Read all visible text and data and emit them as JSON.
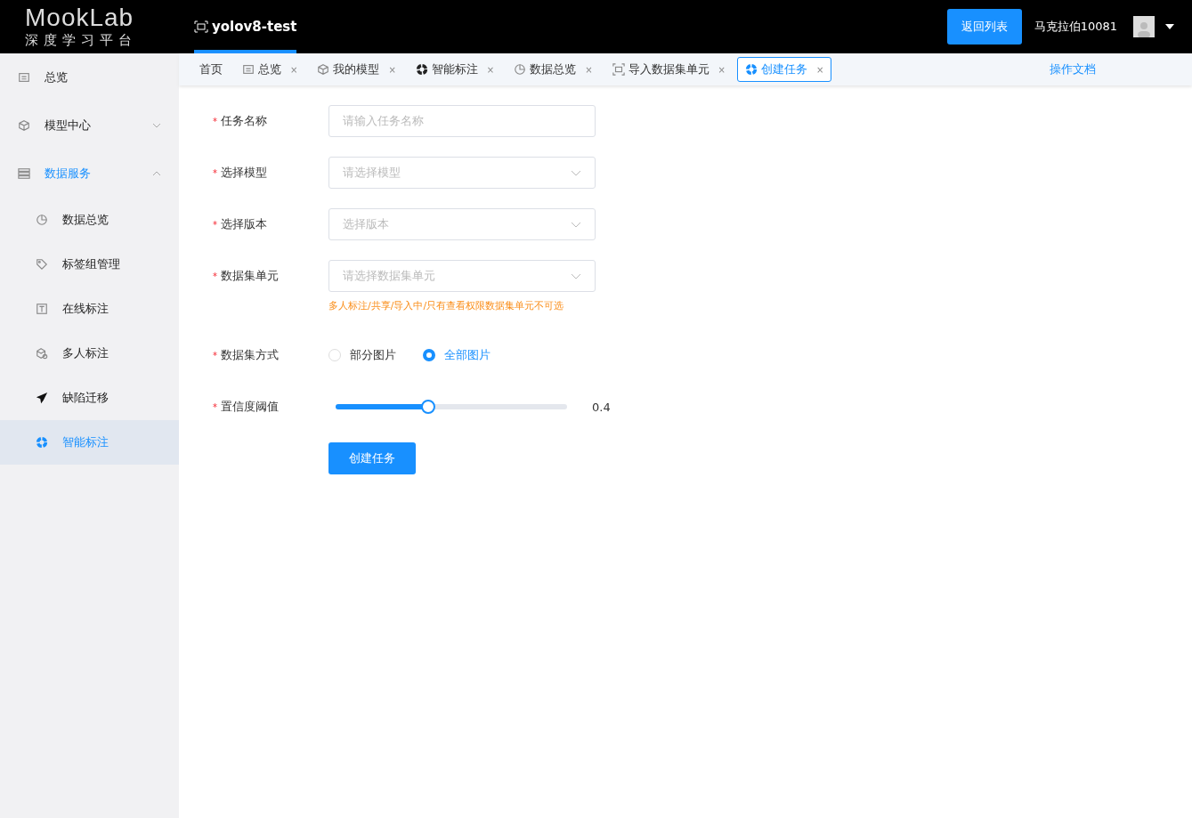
{
  "header": {
    "logo": "MookLab",
    "logo_subtitle": "深度学习平台",
    "project": "yolov8-test",
    "back_button": "返回列表",
    "username": "马克拉伯10081"
  },
  "sidebar": {
    "items": [
      {
        "label": "总览",
        "selected": false
      },
      {
        "label": "模型中心",
        "selected": false,
        "expanded": false
      },
      {
        "label": "数据服务",
        "selected": true,
        "expanded": true,
        "children": [
          {
            "label": "数据总览",
            "selected": false
          },
          {
            "label": "标签组管理",
            "selected": false
          },
          {
            "label": "在线标注",
            "selected": false
          },
          {
            "label": "多人标注",
            "selected": false
          },
          {
            "label": "缺陷迁移",
            "selected": false
          },
          {
            "label": "智能标注",
            "selected": true
          }
        ]
      }
    ]
  },
  "tabs": [
    {
      "label": "首页",
      "selected": false,
      "closable": false
    },
    {
      "label": "总览",
      "selected": false,
      "closable": true
    },
    {
      "label": "我的模型",
      "selected": false,
      "closable": true
    },
    {
      "label": "智能标注",
      "selected": false,
      "closable": true
    },
    {
      "label": "数据总览",
      "selected": false,
      "closable": true
    },
    {
      "label": "导入数据集单元",
      "selected": false,
      "closable": true
    },
    {
      "label": "创建任务",
      "selected": true,
      "closable": true
    }
  ],
  "close_glyph": "×",
  "docs_link": "操作文档",
  "form": {
    "required_mark": "*",
    "fields": [
      {
        "kind": "input",
        "label": "任务名称",
        "placeholder": "请输入任务名称"
      },
      {
        "kind": "select",
        "label": "选择模型",
        "placeholder": "请选择模型"
      },
      {
        "kind": "select",
        "label": "选择版本",
        "placeholder": "选择版本"
      },
      {
        "kind": "select",
        "label": "数据集单元",
        "placeholder": "请选择数据集单元",
        "hint": "多人标注/共享/导入中/只有查看权限数据集单元不可选"
      },
      {
        "kind": "radio",
        "label": "数据集方式",
        "options": [
          {
            "label": "部分图片",
            "selected": false
          },
          {
            "label": "全部图片",
            "selected": true
          }
        ]
      },
      {
        "kind": "slider",
        "label": "置信度阈值",
        "level": 0.4,
        "reading": "0.4"
      }
    ],
    "submit": "创建任务"
  }
}
